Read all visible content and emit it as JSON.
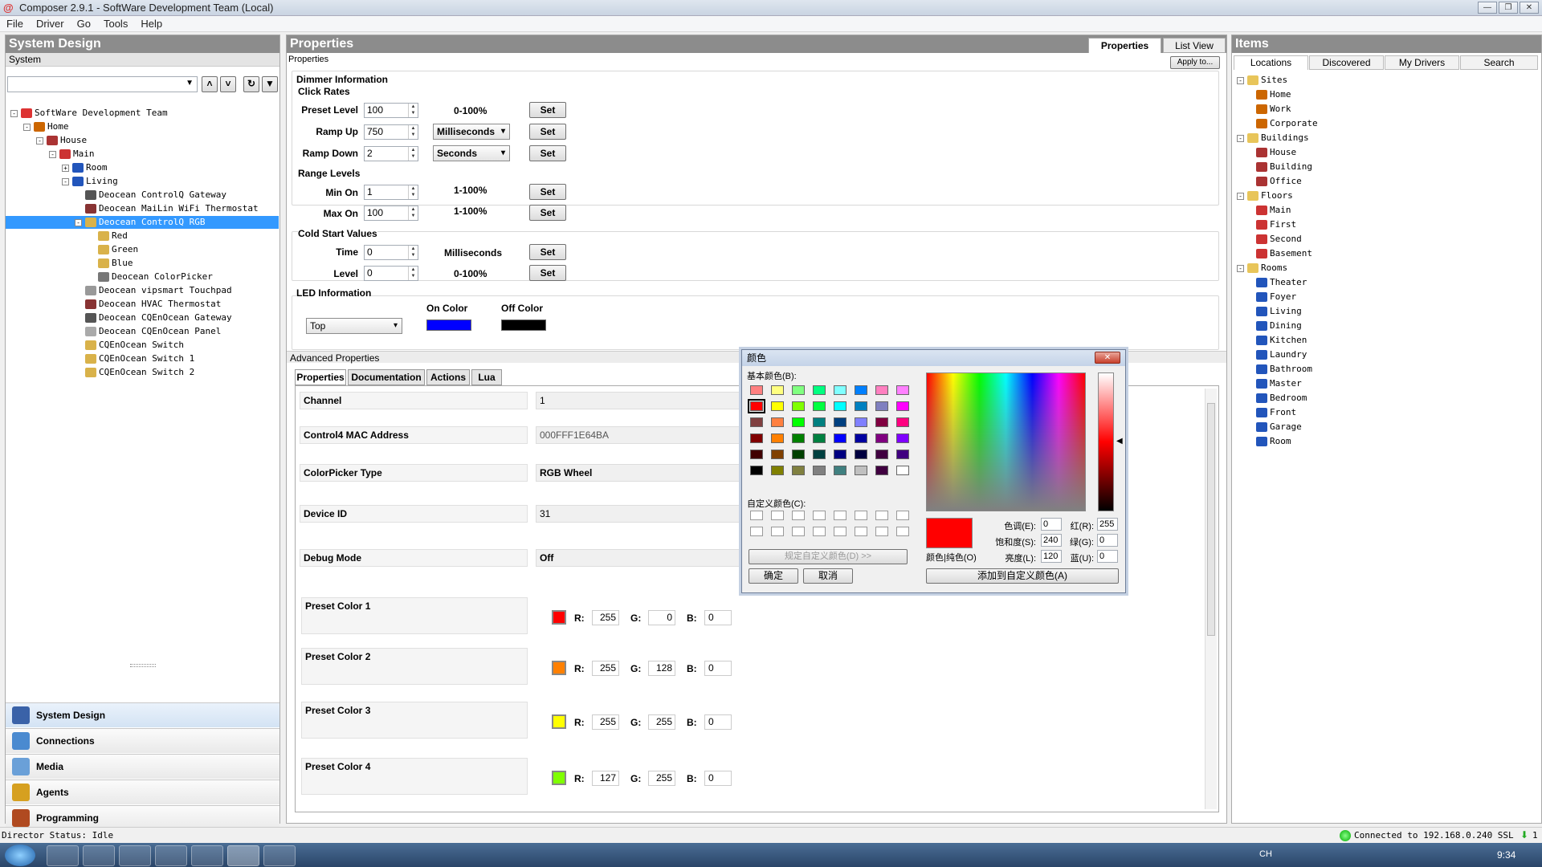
{
  "window": {
    "title": "Composer 2.9.1 - SoftWare Development Team (Local)",
    "app_icon": "composer-logo-icon"
  },
  "menu": [
    "File",
    "Driver",
    "Go",
    "Tools",
    "Help"
  ],
  "left_panel": {
    "title": "System Design",
    "subtitle": "System",
    "tree": [
      {
        "label": "SoftWare Development Team",
        "depth": 0,
        "icon": "project-icon",
        "expander": "-"
      },
      {
        "label": "Home",
        "depth": 1,
        "icon": "site-icon",
        "expander": "-"
      },
      {
        "label": "House",
        "depth": 2,
        "icon": "building-icon",
        "expander": "-"
      },
      {
        "label": "Main",
        "depth": 3,
        "icon": "floor-icon",
        "expander": "-"
      },
      {
        "label": "Room",
        "depth": 4,
        "icon": "room-icon",
        "expander": "+"
      },
      {
        "label": "Living",
        "depth": 4,
        "icon": "room-icon",
        "expander": "-"
      },
      {
        "label": "Deocean ControlQ Gateway",
        "depth": 5,
        "icon": "gateway-icon"
      },
      {
        "label": "Deocean MaiLin WiFi Thermostat",
        "depth": 5,
        "icon": "thermostat-icon"
      },
      {
        "label": "Deocean ControlQ RGB",
        "depth": 5,
        "icon": "light-icon",
        "expander": "-",
        "selected": true
      },
      {
        "label": "Red",
        "depth": 6,
        "icon": "light-icon"
      },
      {
        "label": "Green",
        "depth": 6,
        "icon": "light-icon"
      },
      {
        "label": "Blue",
        "depth": 6,
        "icon": "light-icon"
      },
      {
        "label": "Deocean ColorPicker",
        "depth": 6,
        "icon": "colorpicker-icon"
      },
      {
        "label": "Deocean vipsmart Touchpad",
        "depth": 5,
        "icon": "touchpad-icon"
      },
      {
        "label": "Deocean HVAC Thermostat",
        "depth": 5,
        "icon": "thermostat-icon"
      },
      {
        "label": "Deocean CQEnOcean Gateway",
        "depth": 5,
        "icon": "gateway-icon"
      },
      {
        "label": "Deocean CQEnOcean Panel",
        "depth": 5,
        "icon": "panel-icon"
      },
      {
        "label": "CQEnOcean Switch",
        "depth": 5,
        "icon": "light-icon"
      },
      {
        "label": "CQEnOcean Switch 1",
        "depth": 5,
        "icon": "light-icon"
      },
      {
        "label": "CQEnOcean Switch 2",
        "depth": 5,
        "icon": "light-icon"
      }
    ],
    "nav": [
      {
        "label": "System Design",
        "icon": "system-design-icon",
        "color": "#3a62a8"
      },
      {
        "label": "Connections",
        "icon": "connections-icon",
        "color": "#4a8ad0"
      },
      {
        "label": "Media",
        "icon": "media-icon",
        "color": "#6aa0d8"
      },
      {
        "label": "Agents",
        "icon": "agents-icon",
        "color": "#d6a020"
      },
      {
        "label": "Programming",
        "icon": "programming-icon",
        "color": "#b04a20"
      }
    ]
  },
  "properties": {
    "title": "Properties",
    "tabs": [
      "Properties",
      "List View"
    ],
    "sublabel": "Properties",
    "apply": "Apply to...",
    "dimmer_header": "Dimmer Information",
    "click_rates": "Click Rates",
    "preset_level": {
      "label": "Preset Level",
      "value": "100",
      "range": "0-100%"
    },
    "ramp_up": {
      "label": "Ramp Up",
      "value": "750",
      "unit": "Milliseconds"
    },
    "ramp_down": {
      "label": "Ramp Down",
      "value": "2",
      "unit": "Seconds"
    },
    "range_levels": "Range Levels",
    "min_on": {
      "label": "Min On",
      "value": "1",
      "range": "1-100%"
    },
    "max_on": {
      "label": "Max On",
      "value": "100",
      "range": "1-100%"
    },
    "cold_start": "Cold Start Values",
    "time": {
      "label": "Time",
      "value": "0",
      "unit": "Milliseconds"
    },
    "level": {
      "label": "Level",
      "value": "0",
      "range": "0-100%"
    },
    "set": "Set",
    "led_header": "LED Information",
    "led_select": "Top",
    "on_color_label": "On Color",
    "off_color_label": "Off Color",
    "on_color": "#0000ff",
    "off_color": "#000000"
  },
  "advanced": {
    "title": "Advanced Properties",
    "tabs": [
      "Properties",
      "Documentation",
      "Actions",
      "Lua"
    ],
    "rows": [
      {
        "label": "Channel",
        "value": "1"
      },
      {
        "label": "Control4 MAC Address",
        "value": "000FFF1E64BA"
      },
      {
        "label": "ColorPicker Type",
        "value": "RGB Wheel"
      },
      {
        "label": "Device ID",
        "value": "31"
      },
      {
        "label": "Debug Mode",
        "value": "Off"
      }
    ],
    "presets": [
      {
        "label": "Preset Color 1",
        "r": "255",
        "g": "0",
        "b": "0",
        "color": "#ff0000"
      },
      {
        "label": "Preset Color 2",
        "r": "255",
        "g": "128",
        "b": "0",
        "color": "#ff8000"
      },
      {
        "label": "Preset Color 3",
        "r": "255",
        "g": "255",
        "b": "0",
        "color": "#ffff00"
      },
      {
        "label": "Preset Color 4",
        "r": "127",
        "g": "255",
        "b": "0",
        "color": "#7fff00"
      }
    ],
    "rgb_labels": {
      "r": "R:",
      "g": "G:",
      "b": "B:"
    }
  },
  "items": {
    "title": "Items",
    "tabs": [
      "Locations",
      "Discovered",
      "My Drivers",
      "Search"
    ],
    "tree": [
      {
        "label": "Sites",
        "depth": 0,
        "icon": "folder-icon",
        "expander": "-"
      },
      {
        "label": "Home",
        "depth": 1,
        "icon": "site-icon"
      },
      {
        "label": "Work",
        "depth": 1,
        "icon": "site-icon"
      },
      {
        "label": "Corporate",
        "depth": 1,
        "icon": "site-icon"
      },
      {
        "label": "Buildings",
        "depth": 0,
        "icon": "folder-icon",
        "expander": "-"
      },
      {
        "label": "House",
        "depth": 1,
        "icon": "building-icon"
      },
      {
        "label": "Building",
        "depth": 1,
        "icon": "building-icon"
      },
      {
        "label": "Office",
        "depth": 1,
        "icon": "building-icon"
      },
      {
        "label": "Floors",
        "depth": 0,
        "icon": "folder-icon",
        "expander": "-"
      },
      {
        "label": "Main",
        "depth": 1,
        "icon": "floor-icon"
      },
      {
        "label": "First",
        "depth": 1,
        "icon": "floor-icon"
      },
      {
        "label": "Second",
        "depth": 1,
        "icon": "floor-icon"
      },
      {
        "label": "Basement",
        "depth": 1,
        "icon": "floor-icon"
      },
      {
        "label": "Rooms",
        "depth": 0,
        "icon": "folder-icon",
        "expander": "-"
      },
      {
        "label": "Theater",
        "depth": 1,
        "icon": "room-icon"
      },
      {
        "label": "Foyer",
        "depth": 1,
        "icon": "room-icon"
      },
      {
        "label": "Living",
        "depth": 1,
        "icon": "room-icon"
      },
      {
        "label": "Dining",
        "depth": 1,
        "icon": "room-icon"
      },
      {
        "label": "Kitchen",
        "depth": 1,
        "icon": "room-icon"
      },
      {
        "label": "Laundry",
        "depth": 1,
        "icon": "room-icon"
      },
      {
        "label": "Bathroom",
        "depth": 1,
        "icon": "room-icon"
      },
      {
        "label": "Master",
        "depth": 1,
        "icon": "room-icon"
      },
      {
        "label": "Bedroom",
        "depth": 1,
        "icon": "room-icon"
      },
      {
        "label": "Front",
        "depth": 1,
        "icon": "room-icon"
      },
      {
        "label": "Garage",
        "depth": 1,
        "icon": "room-icon"
      },
      {
        "label": "Room",
        "depth": 1,
        "icon": "room-icon"
      }
    ]
  },
  "color_dialog": {
    "title": "颜色",
    "basic_label": "基本颜色(B):",
    "custom_label": "自定义颜色(C):",
    "define_btn": "规定自定义颜色(D) >>",
    "ok": "确定",
    "cancel": "取消",
    "add_custom": "添加到自定义颜色(A)",
    "color_solid": "颜色|纯色(O)",
    "hue": {
      "label": "色调(E):",
      "value": "0"
    },
    "sat": {
      "label": "饱和度(S):",
      "value": "240"
    },
    "lum": {
      "label": "亮度(L):",
      "value": "120"
    },
    "red": {
      "label": "红(R):",
      "value": "255"
    },
    "green": {
      "label": "绿(G):",
      "value": "0"
    },
    "blue": {
      "label": "蓝(U):",
      "value": "0"
    },
    "current_color": "#ff0000",
    "basic_colors": [
      "#ff8080",
      "#ffff80",
      "#80ff80",
      "#00ff80",
      "#80ffff",
      "#0080ff",
      "#ff80c0",
      "#ff80ff",
      "#ff0000",
      "#ffff00",
      "#80ff00",
      "#00ff40",
      "#00ffff",
      "#0080c0",
      "#8080c0",
      "#ff00ff",
      "#804040",
      "#ff8040",
      "#00ff00",
      "#008080",
      "#004080",
      "#8080ff",
      "#800040",
      "#ff0080",
      "#800000",
      "#ff8000",
      "#008000",
      "#008040",
      "#0000ff",
      "#0000a0",
      "#800080",
      "#8000ff",
      "#400000",
      "#804000",
      "#004000",
      "#004040",
      "#000080",
      "#000040",
      "#400040",
      "#400080",
      "#000000",
      "#808000",
      "#808040",
      "#808080",
      "#408080",
      "#c0c0c0",
      "#400040",
      "#ffffff"
    ]
  },
  "status": {
    "left": "Director Status: Idle",
    "right": "Connected to 192.168.0.240  SSL",
    "count": "1"
  },
  "taskbar": {
    "time": "9:34",
    "lang": "CH"
  }
}
